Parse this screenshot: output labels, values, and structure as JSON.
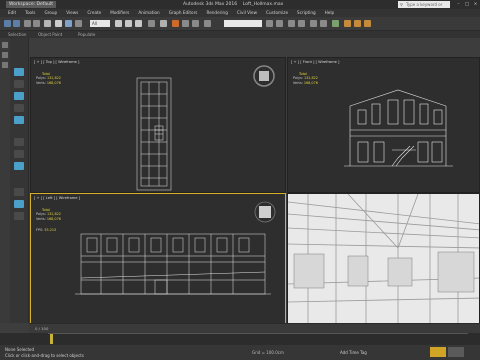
{
  "title_bar": {
    "workspace_label": "Workspace: Default",
    "app_title": "Autodesk 3ds Max 2016",
    "file_name": "Loft_Hollmax.max",
    "search_placeholder": "Type a keyword or phrase"
  },
  "menu": [
    "Edit",
    "Tools",
    "Group",
    "Views",
    "Create",
    "Modifiers",
    "Animation",
    "Graph Editors",
    "Rendering",
    "Civil View",
    "Customize",
    "Scripting",
    "Help"
  ],
  "toolbar": {
    "selection_filter": "All"
  },
  "ribbon": {
    "items": [
      "Selection",
      "Object Paint",
      "Populate"
    ]
  },
  "viewports": {
    "top": {
      "label": "[ + ] [ Top ] [ Wireframe ]",
      "total_label": "Total",
      "polys_label": "Polys:",
      "polys_value": "132,822",
      "verts_label": "Verts:",
      "verts_value": "168,076"
    },
    "front": {
      "label": "[ + ] [ Front ] [ Wireframe ]",
      "total_label": "Total",
      "polys_label": "Polys:",
      "polys_value": "132,822",
      "verts_label": "Verts:",
      "verts_value": "168,076"
    },
    "left": {
      "label": "[ + ] [ Left ] [ Wireframe ]",
      "total_label": "Total",
      "polys_label": "Polys:",
      "polys_value": "132,822",
      "verts_label": "Verts:",
      "verts_value": "168,076",
      "fps_label": "FPS:",
      "fps_value": "55.215"
    }
  },
  "timeline": {
    "frame_text": "0 / 100"
  },
  "status": {
    "selection_text": "None Selected",
    "hint_text": "Click or click-and-drag to select objects",
    "add_time_tag": "Add Time Tag",
    "grid_text": "Grid = 100.0cm"
  },
  "colors": {
    "active_viewport_border": "#d4b026",
    "stats_text": "#e1d23a",
    "wire": "#e6e6e6"
  }
}
